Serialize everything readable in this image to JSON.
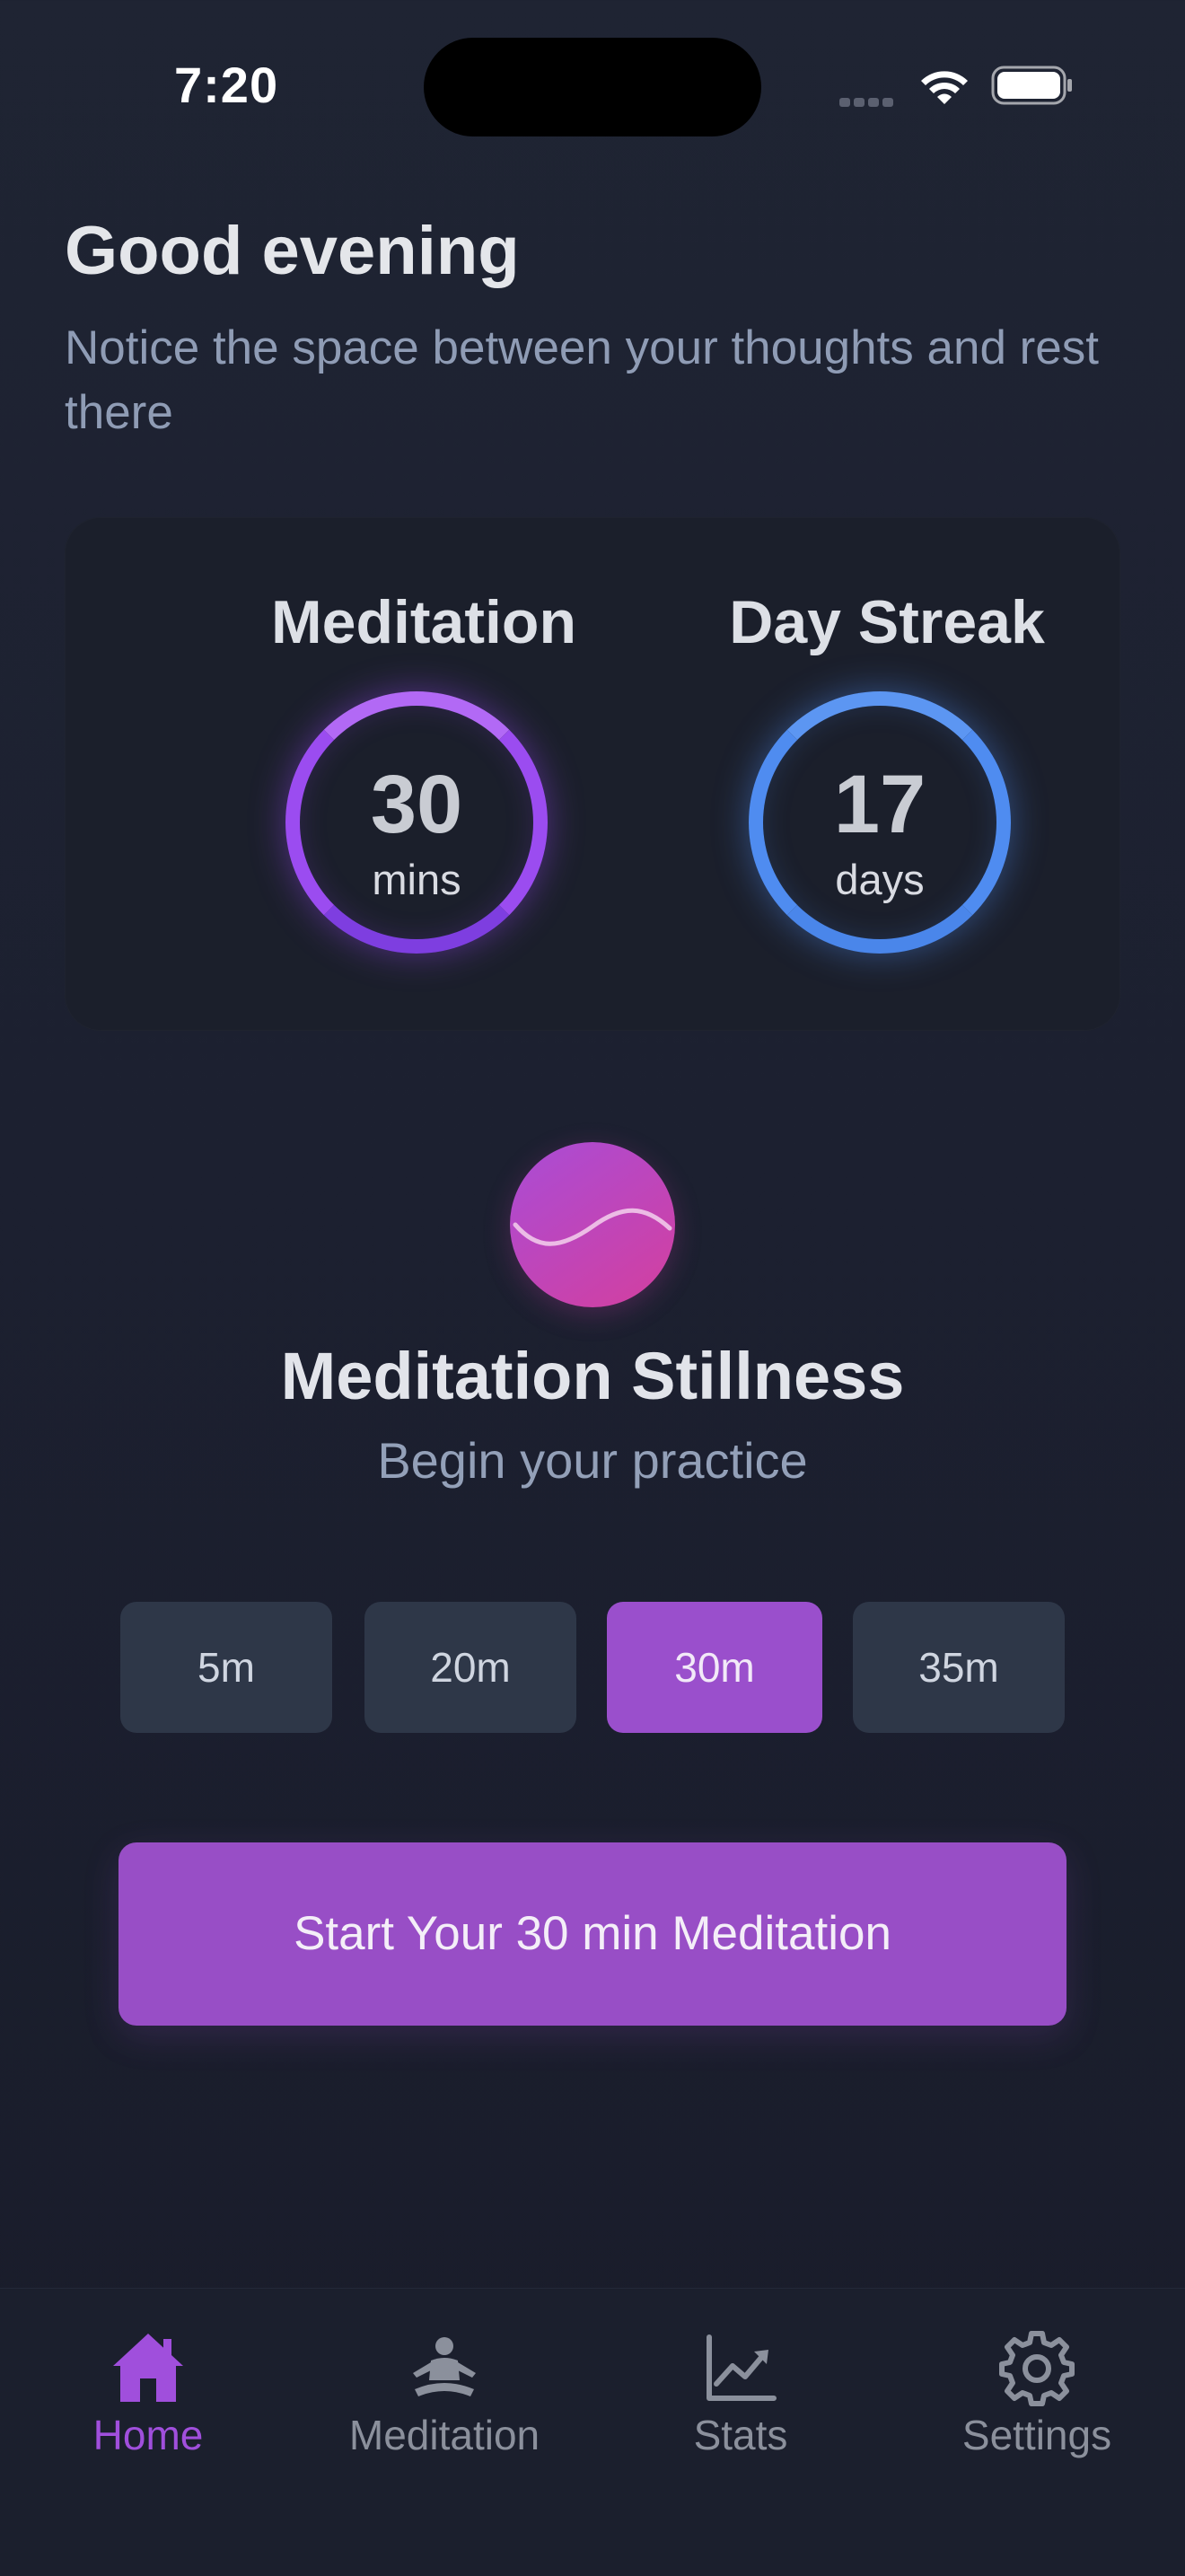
{
  "status_bar": {
    "time": "7:20"
  },
  "header": {
    "greeting": "Good evening",
    "subtitle": "Notice the space between your thoughts and rest there"
  },
  "stats": {
    "meditation": {
      "title": "Meditation",
      "value": "30",
      "unit": "mins"
    },
    "streak": {
      "title": "Day Streak",
      "value": "17",
      "unit": "days"
    }
  },
  "session": {
    "title": "Meditation Stillness",
    "subtitle": "Begin your practice"
  },
  "durations": {
    "options": [
      "5m",
      "20m",
      "30m",
      "35m"
    ],
    "selected": "30m"
  },
  "start_button": {
    "label": "Start Your 30 min Meditation"
  },
  "tab_bar": {
    "tabs": [
      {
        "label": "Home",
        "icon": "home-icon",
        "active": true
      },
      {
        "label": "Meditation",
        "icon": "meditation-icon",
        "active": false
      },
      {
        "label": "Stats",
        "icon": "stats-icon",
        "active": false
      },
      {
        "label": "Settings",
        "icon": "settings-icon",
        "active": false
      }
    ]
  },
  "colors": {
    "accent": "#984ec6",
    "meditation_ring": "#9b4cf0",
    "streak_ring": "#4f8cf0",
    "background": "#1f2433"
  }
}
